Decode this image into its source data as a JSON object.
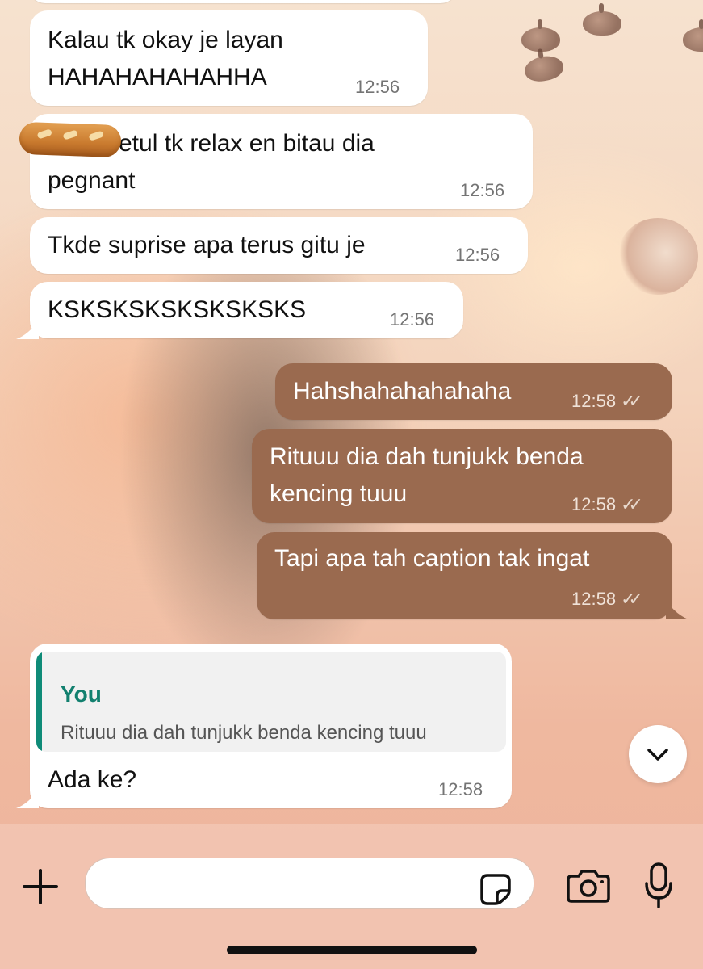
{
  "messages": [
    {
      "direction": "incoming",
      "text": "Kalau tk okay je layan\nHAHAHAHAHAHHA",
      "time": "12:56"
    },
    {
      "direction": "incoming",
      "text": "etul tk relax en bitau dia\npegnant",
      "time": "12:56"
    },
    {
      "direction": "incoming",
      "text": "Tkde suprise apa terus gitu je",
      "time": "12:56"
    },
    {
      "direction": "incoming",
      "text": "KSKSKSKSKSKSKSKS",
      "time": "12:56"
    },
    {
      "direction": "outgoing",
      "text": "Hahshahahahahaha",
      "time": "12:58",
      "status": "read"
    },
    {
      "direction": "outgoing",
      "text": "Rituuu dia dah tunjukk benda\nkencing tuuu",
      "time": "12:58",
      "status": "read"
    },
    {
      "direction": "outgoing",
      "text": "Tapi apa tah caption tak ingat",
      "time": "12:58",
      "status": "read"
    },
    {
      "direction": "incoming",
      "text": "Ada ke?",
      "time": "12:58",
      "reply_to": {
        "author": "You",
        "text": "Rituuu dia dah tunjukk benda kencing tuuu"
      }
    }
  ],
  "colors": {
    "outgoing_bubble": "#9a6a4f",
    "incoming_bubble": "#ffffff",
    "quote_accent": "#0f8b78"
  },
  "icons": {
    "emoji_overlay": "baguette-emoji",
    "scroll_down": "chevron-down-icon",
    "attach": "plus-icon",
    "sticker": "sticker-icon",
    "camera": "camera-icon",
    "mic": "microphone-icon",
    "read_status": "double-check-icon"
  },
  "composer": {
    "placeholder": ""
  }
}
